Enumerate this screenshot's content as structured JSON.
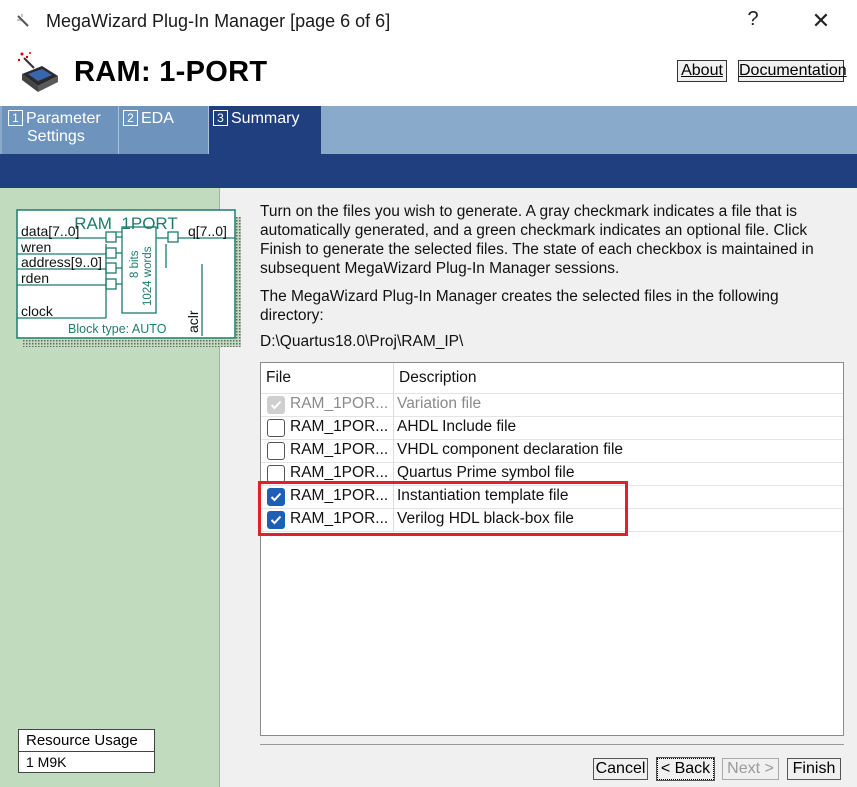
{
  "window": {
    "title": "MegaWizard Plug-In Manager [page 6 of 6]",
    "help_glyph": "?",
    "close_glyph": "✕"
  },
  "header": {
    "heading": "RAM: 1-PORT",
    "about_label": "About",
    "documentation_label": "Documentation"
  },
  "tabs": [
    {
      "num": "1",
      "label_line1": "Parameter",
      "label_line2": "Settings"
    },
    {
      "num": "2",
      "label": "EDA"
    },
    {
      "num": "3",
      "label": "Summary",
      "active": true
    }
  ],
  "symbol": {
    "name": "RAM_1PORT",
    "inputs": [
      "data[7..0]",
      "wren",
      "address[9..0]",
      "rden",
      "clock"
    ],
    "output": "q[7..0]",
    "mem_bits": "8 bits",
    "mem_words": "1024 words",
    "aclr": "aclr",
    "block_type": "Block type: AUTO"
  },
  "resource": {
    "header": "Resource Usage",
    "value": "1 M9K"
  },
  "main": {
    "description": "Turn on the files you wish to generate. A gray checkmark indicates a file that is automatically generated, and a green checkmark indicates an optional file. Click Finish to generate the selected files. The state of each checkbox is maintained in subsequent MegaWizard Plug-In Manager sessions.",
    "dir_intro": "The MegaWizard Plug-In Manager creates the selected files in the following directory:",
    "dir_path": "D:\\Quartus18.0\\Proj\\RAM_IP\\"
  },
  "files": {
    "col_file": "File",
    "col_desc": "Description",
    "rows": [
      {
        "name": "RAM_1POR...",
        "desc": "Variation file",
        "state": "auto"
      },
      {
        "name": "RAM_1POR...",
        "desc": "AHDL Include file",
        "state": "off"
      },
      {
        "name": "RAM_1POR...",
        "desc": "VHDL component declaration file",
        "state": "off"
      },
      {
        "name": "RAM_1POR...",
        "desc": "Quartus Prime symbol file",
        "state": "off"
      },
      {
        "name": "RAM_1POR...",
        "desc": "Instantiation template file",
        "state": "on"
      },
      {
        "name": "RAM_1POR...",
        "desc": "Verilog HDL black-box file",
        "state": "on"
      }
    ]
  },
  "buttons": {
    "cancel": "Cancel",
    "back": "< Back",
    "next": "Next >",
    "finish": "Finish"
  },
  "colors": {
    "accent": "#1f3f7f",
    "tab": "#6e94bd",
    "left_pane": "#c1dbbf",
    "highlight": "#e0202a",
    "checkbox_on": "#1d5fb5"
  }
}
